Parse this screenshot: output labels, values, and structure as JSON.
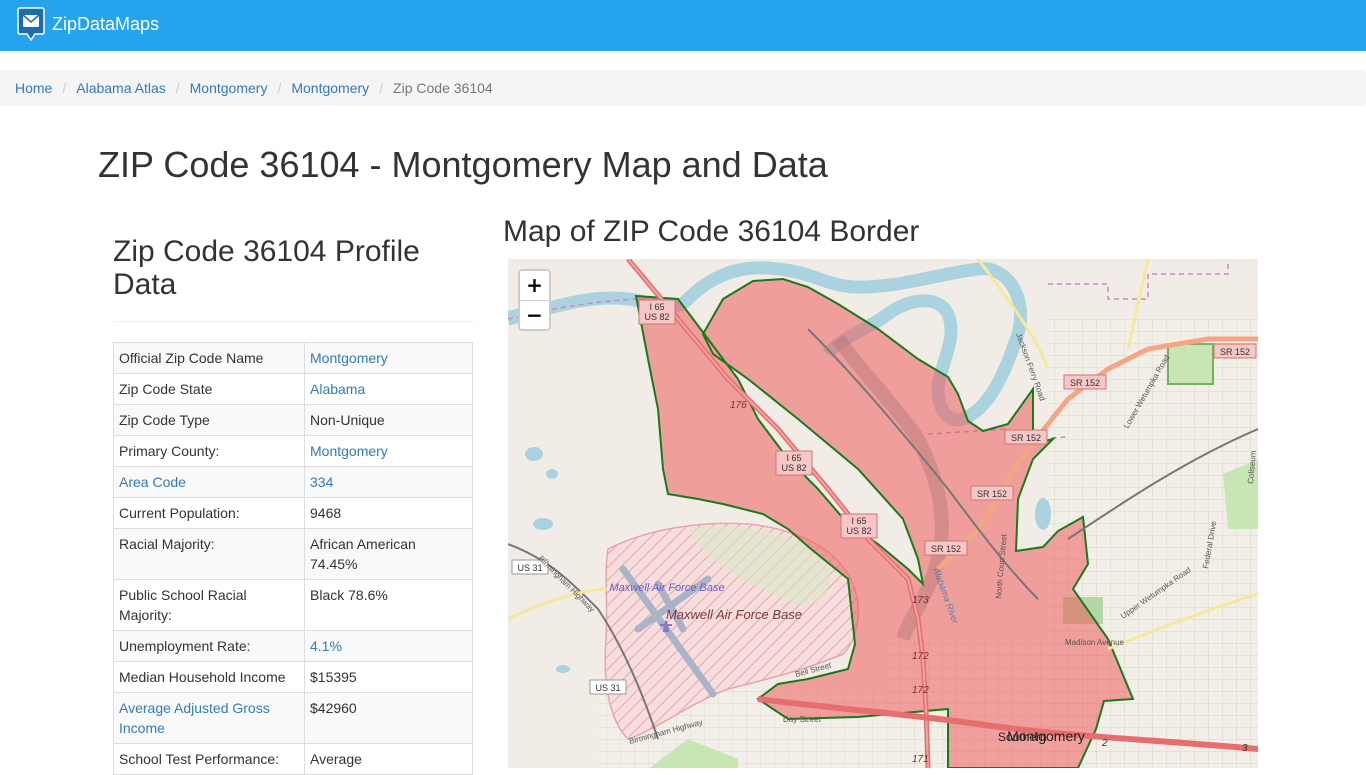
{
  "navbar": {
    "brand": "ZipDataMaps",
    "brand_color": "#23a4ec"
  },
  "breadcrumb": [
    "Home",
    "Alabama Atlas",
    "Montgomery",
    "Montgomery",
    "Zip Code 36104"
  ],
  "page_title": "ZIP Code 36104 - Montgomery Map and Data",
  "profile": {
    "title": "Zip Code 36104 Profile Data",
    "rows": [
      {
        "label": "Official Zip Code Name",
        "value": "Montgomery"
      },
      {
        "label": "Zip Code State",
        "value": "Alabama"
      },
      {
        "label": "Zip Code Type",
        "value": "Non-Unique"
      },
      {
        "label": "Primary County:",
        "value": "Montgomery"
      },
      {
        "label": "Area Code",
        "value": "334"
      },
      {
        "label": "Current Population:",
        "value": "9468"
      },
      {
        "label": "Racial Majority:",
        "value": "African American 74.45%"
      },
      {
        "label": "Public School Racial Majority:",
        "value": "Black 78.6%"
      },
      {
        "label": "Unemployment Rate:",
        "value": "4.1%"
      },
      {
        "label": "Median Household Income",
        "value": "$15395"
      },
      {
        "label": "Average Adjusted Gross Income",
        "value": "$42960"
      },
      {
        "label": "School Test Performance:",
        "value": "Average"
      }
    ]
  },
  "map": {
    "title": "Map of ZIP Code 36104 Border",
    "zoom_in": "+",
    "zoom_out": "−",
    "labels": {
      "i65_us82_a": "I 65",
      "i65_us82_b": "US 82",
      "sr152": "SR 152",
      "us31": "US 31",
      "exit176": "176",
      "exit173": "173",
      "exit172": "172",
      "exit171": "171",
      "maxwell_small": "Maxwell Air Force Base",
      "maxwell_large": "Maxwell Air Force Base",
      "montgomery": "Montgomery",
      "southern": "Southern",
      "jackson_ferry": "Jackson Ferry Road",
      "lower_wetumpka": "Lower Wetumpka Road",
      "upper_wetumpka": "Upper Wetumpka Road",
      "federal_drive": "Federal Drive",
      "coliseum": "Coliseum",
      "north_court": "North Court Street",
      "madison": "Madison Avenue",
      "bell_street": "Bell Street",
      "day_street": "Day Street",
      "birmingham_hwy": "Birmingham Highway",
      "alabama_river": "Alabama River",
      "num2": "2",
      "num3": "3"
    },
    "colors": {
      "zip_fill": "#ef5d5d",
      "zip_border": "#1a7a1a",
      "water": "#aad3df",
      "land": "#f1ede6"
    }
  }
}
